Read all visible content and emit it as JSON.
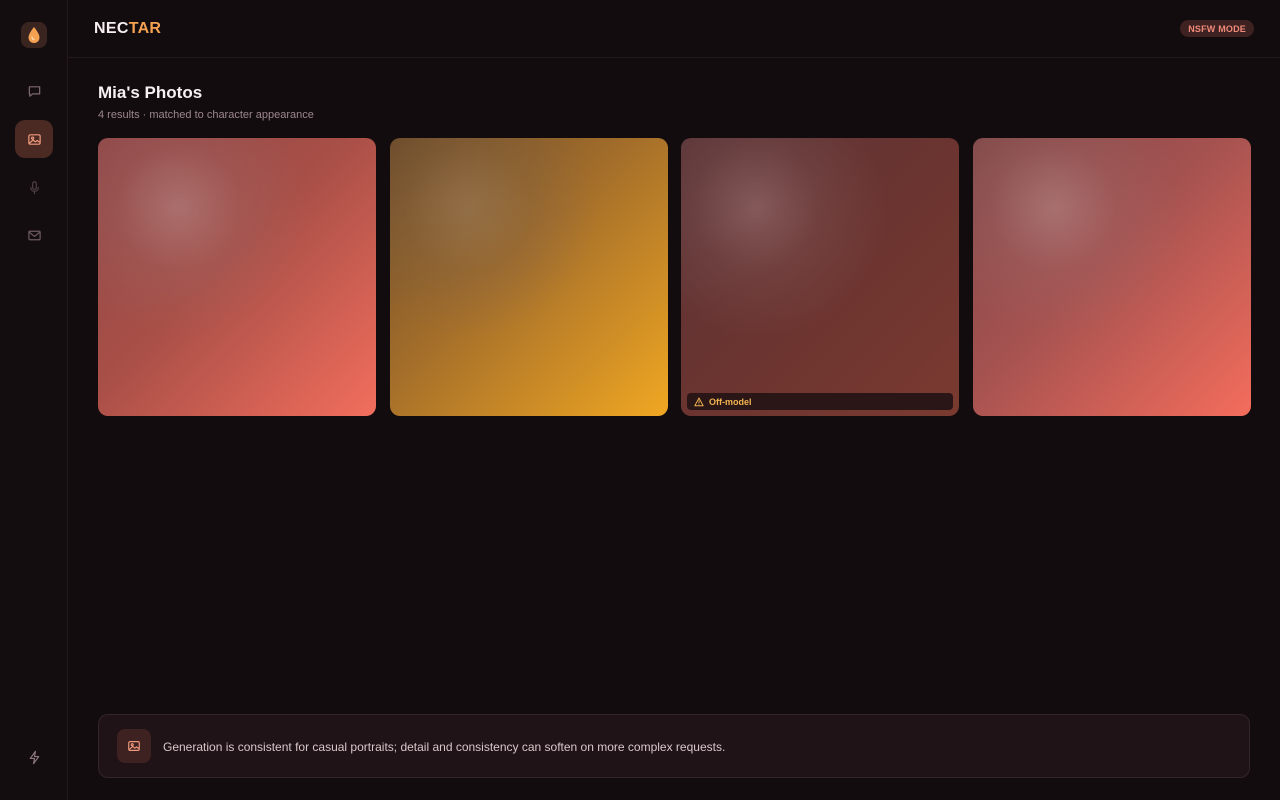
{
  "brand": {
    "part1": "NEC",
    "part2": "TAR"
  },
  "header": {
    "mode_badge": "NSFW MODE"
  },
  "page": {
    "title": "Mia's Photos",
    "subtitle": "4 results · matched to character appearance"
  },
  "photos": [
    {
      "flag": null
    },
    {
      "flag": null
    },
    {
      "flag": "Off-model"
    },
    {
      "flag": null
    }
  ],
  "note": {
    "text": "Generation is consistent for casual portraits; detail and consistency can soften on more complex requests."
  },
  "sidebar": {
    "items": [
      {
        "icon": "chat-icon",
        "active": false
      },
      {
        "icon": "image-icon",
        "active": true
      },
      {
        "icon": "mic-icon",
        "active": false
      },
      {
        "icon": "mail-icon",
        "active": false
      }
    ],
    "bottom_icon": "bolt-icon"
  },
  "colors": {
    "accent": "#f4a251",
    "active_nav_bg": "#4a2a22",
    "badge_text": "#ef8a79",
    "warning": "#f1b44f"
  }
}
